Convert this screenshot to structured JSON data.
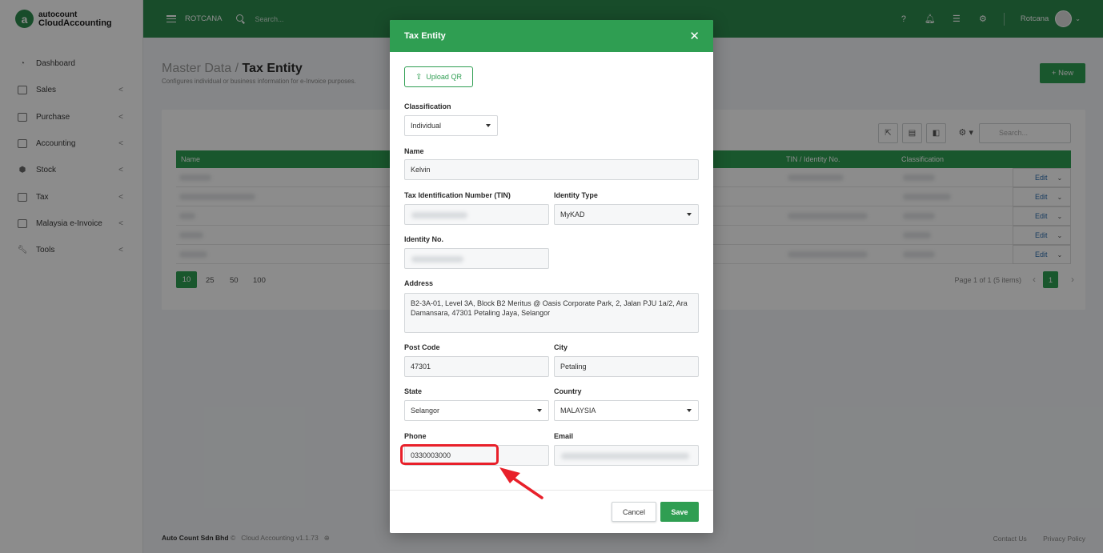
{
  "brand": {
    "top": "autocount",
    "bottom": "CloudAccounting",
    "logo_letter": "a"
  },
  "sidebar": {
    "items": [
      {
        "label": "Dashboard",
        "icon": "dashboard-icon",
        "has_chevron": false
      },
      {
        "label": "Sales",
        "icon": "sales-icon",
        "has_chevron": true
      },
      {
        "label": "Purchase",
        "icon": "purchase-icon",
        "has_chevron": true
      },
      {
        "label": "Accounting",
        "icon": "accounting-icon",
        "has_chevron": true
      },
      {
        "label": "Stock",
        "icon": "stock-icon",
        "has_chevron": true
      },
      {
        "label": "Tax",
        "icon": "tax-icon",
        "has_chevron": true
      },
      {
        "label": "Malaysia e-Invoice",
        "icon": "einvoice-icon",
        "has_chevron": true
      },
      {
        "label": "Tools",
        "icon": "wrench-icon",
        "has_chevron": true
      }
    ],
    "chevron": "<"
  },
  "topbar": {
    "company": "ROTCANA",
    "search_placeholder": "Search...",
    "username": "Rotcana",
    "icons": [
      "help-icon",
      "bell-icon",
      "grid-icon",
      "gear-icon"
    ]
  },
  "page": {
    "title_prefix": "Master Data / ",
    "title": "Tax Entity",
    "subtitle": "Configures individual or business information for e-Invoice purposes.",
    "new_button": "+ New"
  },
  "list": {
    "search_placeholder": "Search...",
    "columns": [
      "Name",
      "TIN / Identity No.",
      "Classification"
    ],
    "edit_label": "Edit",
    "row_count": 5,
    "page_sizes": [
      "10",
      "25",
      "50",
      "100"
    ],
    "page_info": "Page 1 of 1 (5 items)",
    "current_page": "1"
  },
  "footer": {
    "company": "Auto Count Sdn Bhd",
    "copyright": "©",
    "version": "Cloud Accounting v1.1.73",
    "links": [
      "Contact Us",
      "Privacy Policy"
    ]
  },
  "modal": {
    "title": "Tax Entity",
    "upload_label": "Upload QR",
    "fields": {
      "classification": {
        "label": "Classification",
        "value": "Individual"
      },
      "name": {
        "label": "Name",
        "value": "Kelvin"
      },
      "tin": {
        "label": "Tax Identification Number (TIN)"
      },
      "identity_type": {
        "label": "Identity Type",
        "value": "MyKAD"
      },
      "identity_no": {
        "label": "Identity No."
      },
      "address": {
        "label": "Address",
        "value": "B2-3A-01, Level 3A, Block B2 Meritus @ Oasis Corporate Park, 2, Jalan PJU 1a/2, Ara Damansara, 47301 Petaling Jaya, Selangor"
      },
      "post_code": {
        "label": "Post Code",
        "value": "47301"
      },
      "city": {
        "label": "City",
        "value": "Petaling"
      },
      "state": {
        "label": "State",
        "value": "Selangor"
      },
      "country": {
        "label": "Country",
        "value": "MALAYSIA"
      },
      "phone": {
        "label": "Phone",
        "value": "0330003000"
      },
      "email": {
        "label": "Email"
      }
    },
    "cancel_label": "Cancel",
    "save_label": "Save"
  },
  "colors": {
    "primary": "#2f9e52",
    "topbar": "#2d8a4e",
    "highlight": "#e8202a"
  }
}
